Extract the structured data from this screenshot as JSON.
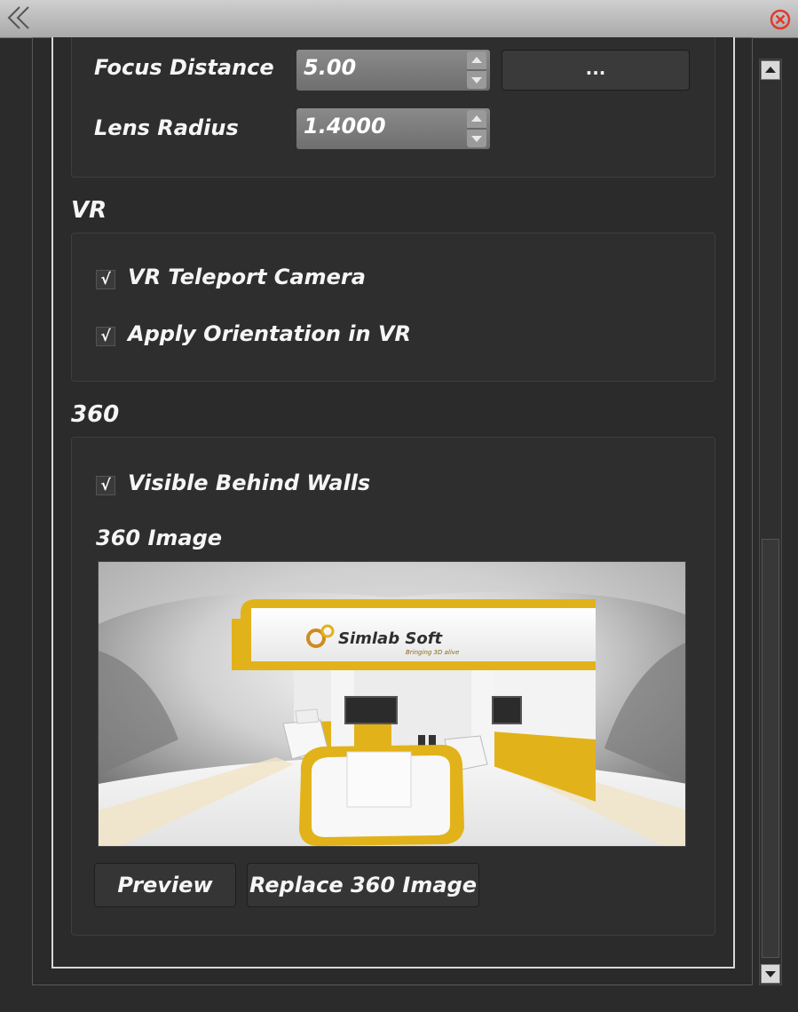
{
  "camera": {
    "focus_distance_label": "Focus Distance",
    "focus_distance_value": "5.00",
    "lens_radius_label": "Lens Radius",
    "lens_radius_value": "1.4000",
    "browse_button_label": "..."
  },
  "vr": {
    "section_title": "VR",
    "teleport_label": "VR Teleport Camera",
    "teleport_checked": true,
    "orientation_label": "Apply Orientation in VR",
    "orientation_checked": true
  },
  "pano": {
    "section_title": "360",
    "visible_label": "Visible Behind Walls",
    "visible_checked": true,
    "image_label": "360 Image",
    "image_logo_text": "Simlab Soft",
    "image_logo_tagline": "Bringing 3D alive",
    "preview_button": "Preview",
    "replace_button": "Replace 360 Image"
  },
  "check_mark": "√",
  "icons": {
    "collapse": "double-chevron-left-icon",
    "close": "close-circle-icon",
    "scroll_up": "triangle-up-icon",
    "scroll_down": "triangle-down-icon"
  },
  "colors": {
    "panel_bg": "#2b2b2b",
    "titlebar": "#bdbdbd",
    "close_red": "#e03a2f",
    "accent_yellow": "#e2b21a"
  }
}
